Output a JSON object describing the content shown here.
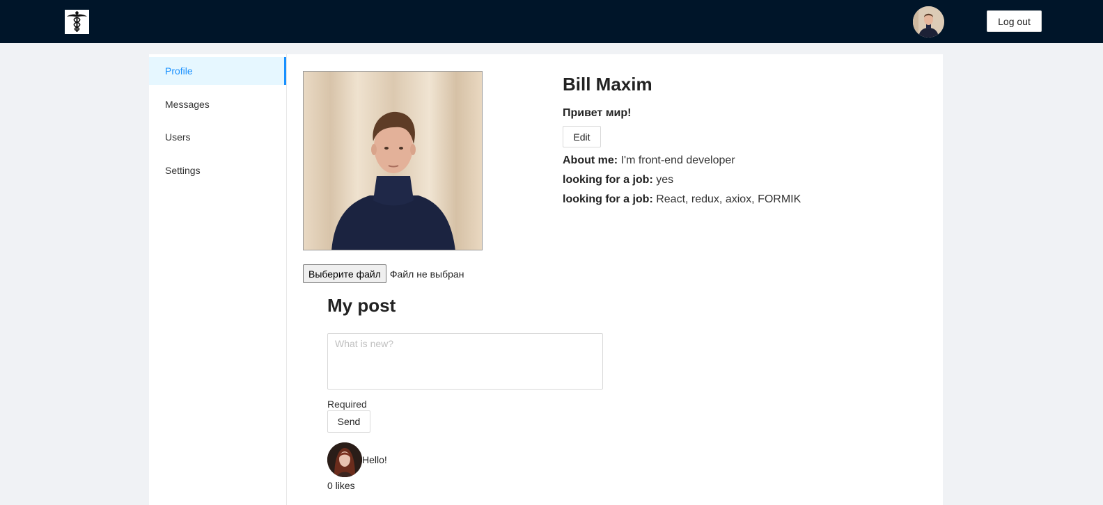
{
  "header": {
    "logo": "caduceus-logo",
    "avatar": "user-avatar",
    "logout_label": "Log out"
  },
  "sidebar": {
    "items": [
      {
        "label": "Profile",
        "active": true
      },
      {
        "label": "Messages",
        "active": false
      },
      {
        "label": "Users",
        "active": false
      },
      {
        "label": "Settings",
        "active": false
      }
    ]
  },
  "profile": {
    "name": "Bill Maxim",
    "status": "Привет мир!",
    "edit_label": "Edit",
    "about_label": "About me:",
    "about_value": "I'm front-end developer",
    "job_label": "looking for a job:",
    "job_value": "yes",
    "skills_label": "looking for a job:",
    "skills_value": "React, redux, axiox, FORMIK",
    "file_button": "Выберите файл",
    "file_status": "Файл не выбран"
  },
  "posts": {
    "title": "My post",
    "placeholder": "What is new?",
    "validation": "Required",
    "send_label": "Send",
    "items": [
      {
        "text": "Hello!",
        "likes": "0 likes"
      }
    ]
  },
  "colors": {
    "header_bg": "#001529",
    "accent": "#1890ff",
    "active_bg": "#e6f7ff",
    "page_bg": "#f0f2f5"
  }
}
